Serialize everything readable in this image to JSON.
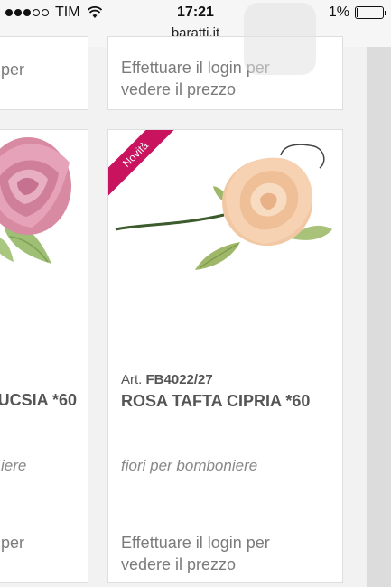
{
  "status_bar": {
    "carrier": "TIM",
    "time": "17:21",
    "battery": "1%",
    "battery_level": 0.01,
    "signal_icon": "signal-dots-icon",
    "wifi_icon": "wifi-icon",
    "battery_icon": "battery-icon"
  },
  "browser": {
    "host": "baratti.it"
  },
  "colors": {
    "ribbon": "#c9135f",
    "text_dark": "#555555",
    "text_light": "#7b7b7b"
  },
  "products": [
    {
      "id": "left-top",
      "login_line1": "Effettuare il login per",
      "login_line1_visible": "per",
      "login_line2": ""
    },
    {
      "id": "right-top",
      "login_line1": "Effettuare il login per",
      "login_line2": "vedere il prezzo"
    },
    {
      "id": "left-main",
      "name_visible": "UCSIA *60",
      "category_visible": "iere",
      "login_line1_visible": "per"
    },
    {
      "id": "right-main",
      "badge": "Novità",
      "art_label": "Art.",
      "art_code": "FB4022/27",
      "name": "ROSA TAFTA CIPRIA *60",
      "category": "fiori per bomboniere",
      "login_line1": "Effettuare il login per",
      "login_line2": "vedere il prezzo"
    }
  ]
}
